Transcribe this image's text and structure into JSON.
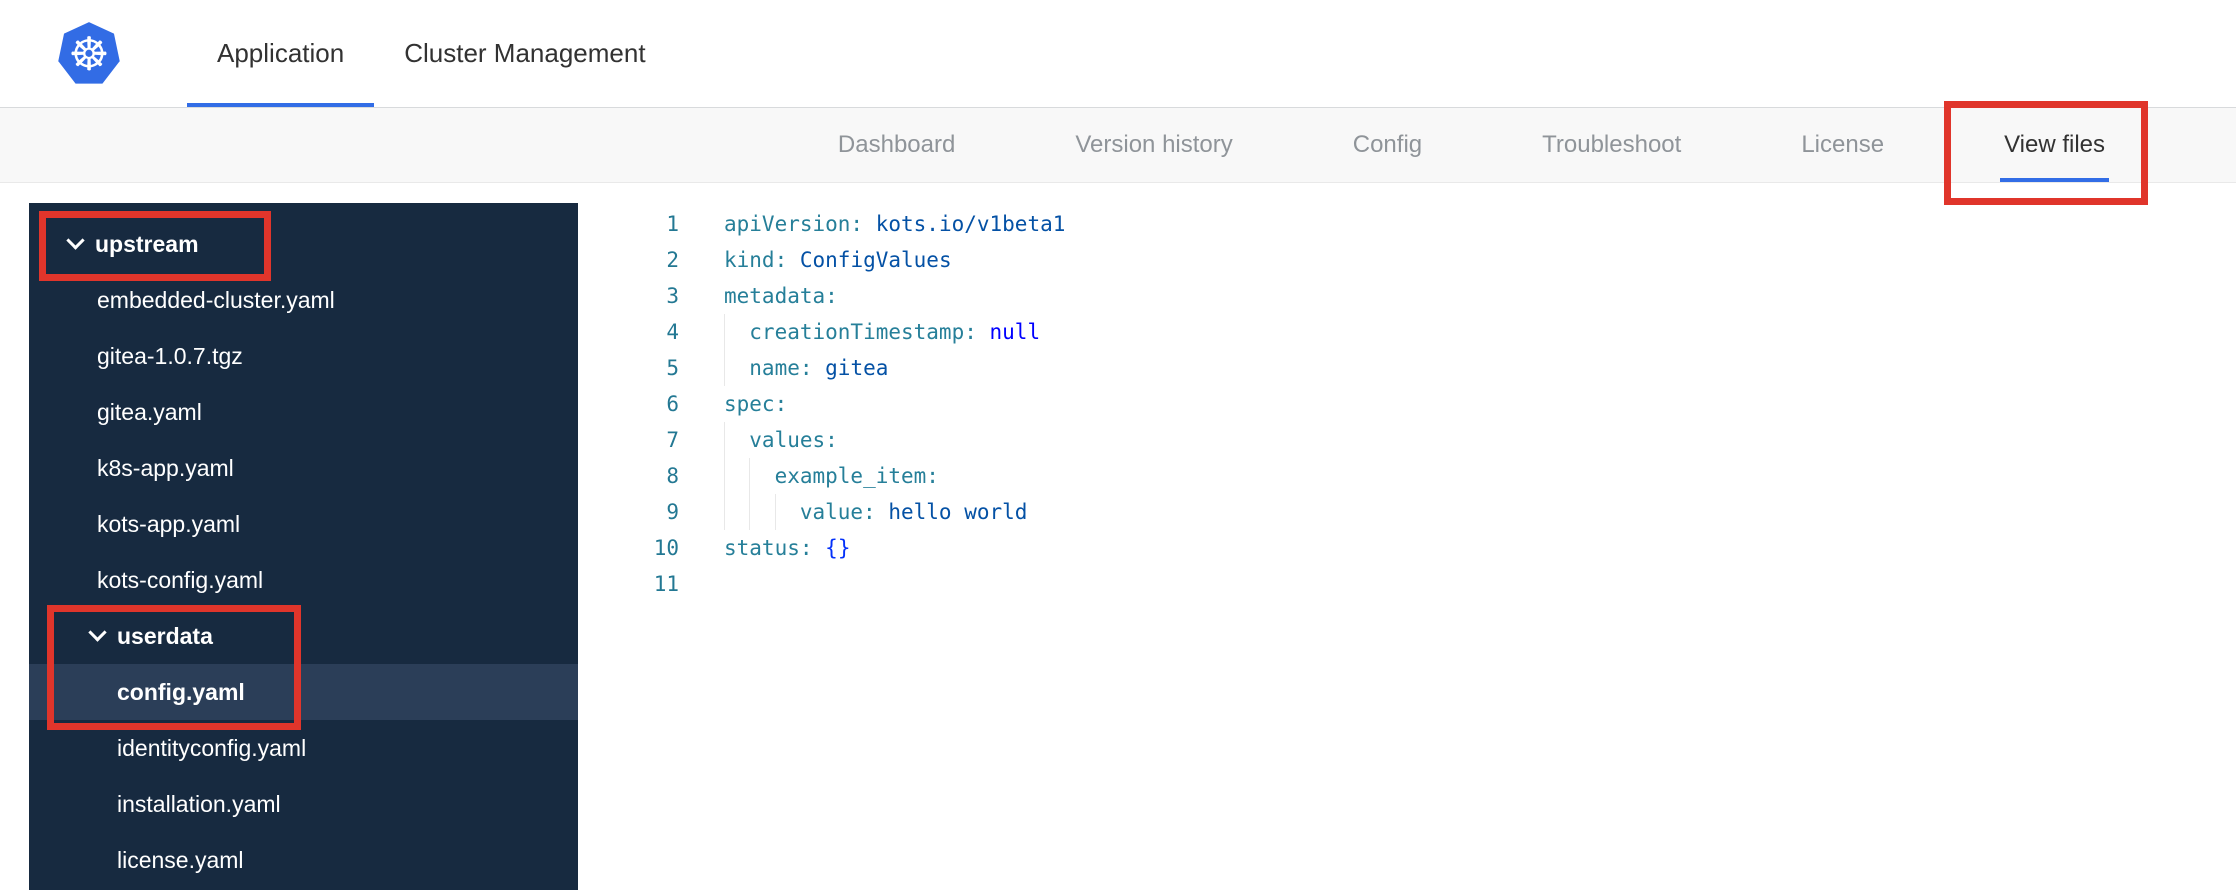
{
  "colors": {
    "accent_blue": "#326de6",
    "annotation_red": "#e0352b",
    "logo_blue": "#326ce5",
    "sidebar_bg": "#172a40",
    "sidebar_selected_bg": "#2b3e58",
    "line_number": "#237893",
    "code_key": "#267f99",
    "code_value": "#0451a5",
    "code_keyword": "#0000ff",
    "code_bracket": "#0431fa"
  },
  "header": {
    "logo_icon": "kubernetes-helm-icon",
    "tabs": [
      {
        "label": "Application",
        "active": true
      },
      {
        "label": "Cluster Management",
        "active": false
      }
    ]
  },
  "subnav": {
    "tabs": [
      {
        "label": "Dashboard",
        "active": false
      },
      {
        "label": "Version history",
        "active": false
      },
      {
        "label": "Config",
        "active": false
      },
      {
        "label": "Troubleshoot",
        "active": false
      },
      {
        "label": "License",
        "active": false
      },
      {
        "label": "View files",
        "active": true,
        "annotated": true
      }
    ]
  },
  "file_tree": {
    "items": [
      {
        "label": "upstream",
        "type": "folder",
        "level": 0,
        "expanded": true,
        "annotated": true
      },
      {
        "label": "embedded-cluster.yaml",
        "type": "file",
        "level": 1
      },
      {
        "label": "gitea-1.0.7.tgz",
        "type": "file",
        "level": 1
      },
      {
        "label": "gitea.yaml",
        "type": "file",
        "level": 1
      },
      {
        "label": "k8s-app.yaml",
        "type": "file",
        "level": 1
      },
      {
        "label": "kots-app.yaml",
        "type": "file",
        "level": 1
      },
      {
        "label": "kots-config.yaml",
        "type": "file",
        "level": 1
      },
      {
        "label": "userdata",
        "type": "folder",
        "level": 1,
        "expanded": true,
        "annotated": true
      },
      {
        "label": "config.yaml",
        "type": "file",
        "level": 2,
        "selected": true,
        "annotated": true
      },
      {
        "label": "identityconfig.yaml",
        "type": "file",
        "level": 2
      },
      {
        "label": "installation.yaml",
        "type": "file",
        "level": 2
      },
      {
        "label": "license.yaml",
        "type": "file",
        "level": 2
      }
    ]
  },
  "editor": {
    "language": "yaml",
    "lines": [
      {
        "indent": 0,
        "tokens": [
          {
            "c": "key",
            "t": "apiVersion:"
          },
          {
            "c": "plain",
            "t": " "
          },
          {
            "c": "val",
            "t": "kots.io/v1beta1"
          }
        ]
      },
      {
        "indent": 0,
        "tokens": [
          {
            "c": "key",
            "t": "kind:"
          },
          {
            "c": "plain",
            "t": " "
          },
          {
            "c": "val",
            "t": "ConfigValues"
          }
        ]
      },
      {
        "indent": 0,
        "tokens": [
          {
            "c": "key",
            "t": "metadata:"
          }
        ]
      },
      {
        "indent": 1,
        "tokens": [
          {
            "c": "key",
            "t": "creationTimestamp:"
          },
          {
            "c": "plain",
            "t": " "
          },
          {
            "c": "kw",
            "t": "null"
          }
        ]
      },
      {
        "indent": 1,
        "tokens": [
          {
            "c": "key",
            "t": "name:"
          },
          {
            "c": "plain",
            "t": " "
          },
          {
            "c": "val",
            "t": "gitea"
          }
        ]
      },
      {
        "indent": 0,
        "tokens": [
          {
            "c": "key",
            "t": "spec:"
          }
        ]
      },
      {
        "indent": 1,
        "tokens": [
          {
            "c": "key",
            "t": "values:"
          }
        ]
      },
      {
        "indent": 2,
        "tokens": [
          {
            "c": "key",
            "t": "example_item:"
          }
        ]
      },
      {
        "indent": 3,
        "tokens": [
          {
            "c": "key",
            "t": "value:"
          },
          {
            "c": "plain",
            "t": " "
          },
          {
            "c": "val",
            "t": "hello world"
          }
        ]
      },
      {
        "indent": 0,
        "tokens": [
          {
            "c": "key",
            "t": "status:"
          },
          {
            "c": "plain",
            "t": " "
          },
          {
            "c": "br",
            "t": "{}"
          }
        ]
      },
      {
        "indent": 0,
        "tokens": []
      }
    ]
  },
  "annotations": [
    {
      "name": "view-files-annotation"
    },
    {
      "name": "upstream-annotation"
    },
    {
      "name": "userdata-config-annotation"
    }
  ]
}
